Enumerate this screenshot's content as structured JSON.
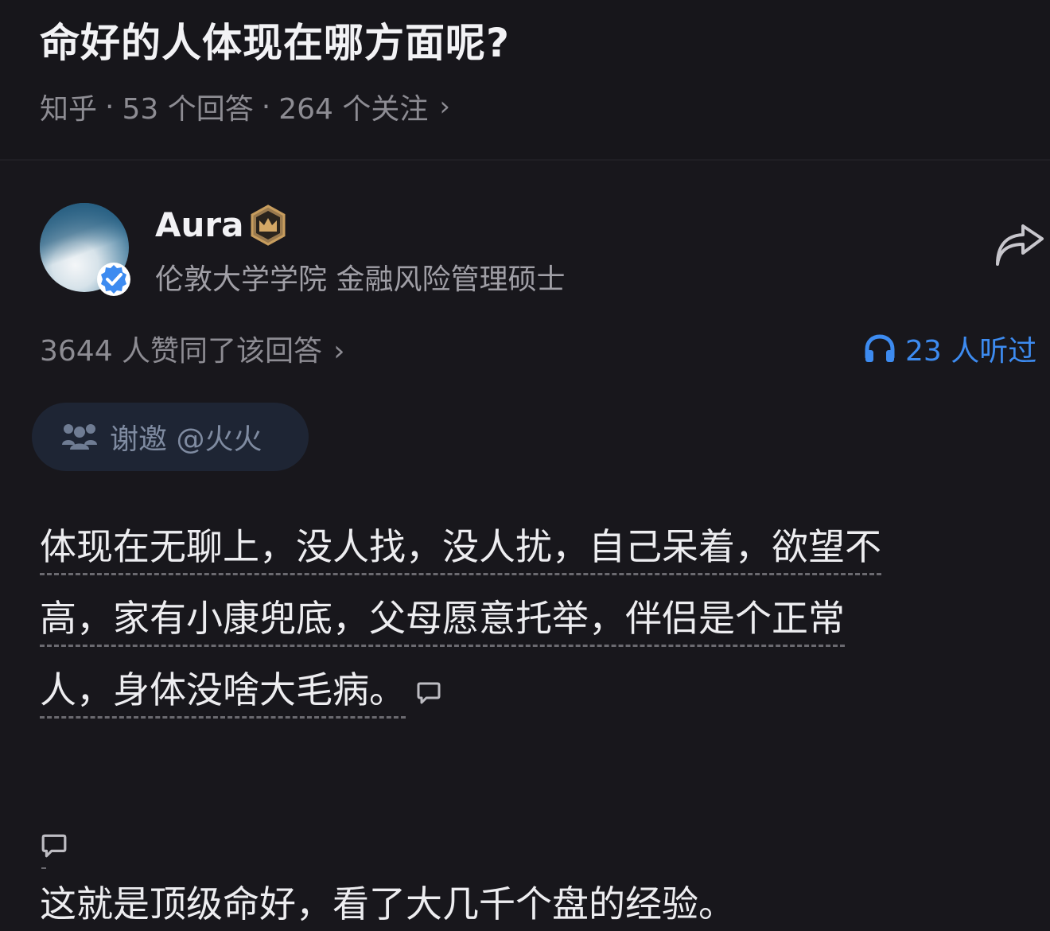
{
  "question": {
    "title": "命好的人体现在哪方面呢?",
    "source": "知乎",
    "separator": "·",
    "answers_count": "53 个回答",
    "followers_count": "264 个关注",
    "chevron": "›"
  },
  "author": {
    "name": "Aura",
    "headline": "伦敦大学学院 金融风险管理硕士",
    "avatar_icon": "avatar",
    "badge_icon": "verified-check-icon",
    "level_icon": "crown-badge-icon"
  },
  "stats": {
    "votes_text": "3644 人赞同了该回答",
    "votes_chevron": "›",
    "listen_text": "23 人听过",
    "listen_color": "#3d8bf0"
  },
  "thanks": {
    "label": "谢邀 @火火"
  },
  "answer": {
    "lines": [
      "体现在无聊上，没人找，没人扰，自己呆着，欲望不",
      "高，家有小康兜底，父母愿意托举，伴侣是个正常",
      "人，身体没啥大毛病。"
    ],
    "conclusion": "这就是顶级命好，看了大几千个盘的经验。"
  },
  "colors": {
    "background": "#18171c",
    "text": "#ededf0",
    "muted": "#8d8c93",
    "accent": "#3d8bf0"
  }
}
